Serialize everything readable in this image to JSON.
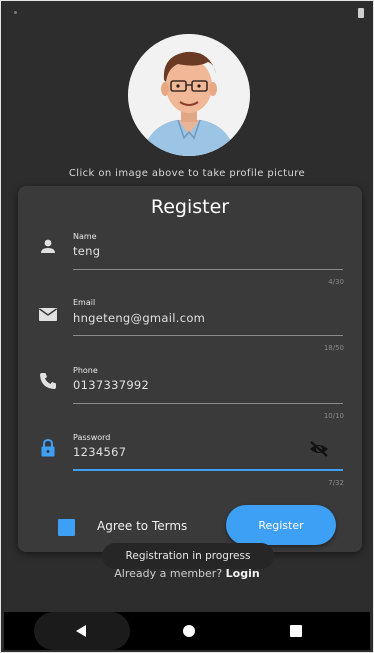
{
  "hint_text": "Click on image above to take profile picture",
  "card": {
    "title": "Register",
    "fields": [
      {
        "label": "Name",
        "value": "teng",
        "counter": "4/30",
        "icon": "person-icon"
      },
      {
        "label": "Email",
        "value": "hngeteng@gmail.com",
        "counter": "18/50",
        "icon": "mail-icon"
      },
      {
        "label": "Phone",
        "value": "0137337992",
        "counter": "10/10",
        "icon": "phone-icon"
      },
      {
        "label": "Password",
        "value": "1234567",
        "counter": "7/32",
        "icon": "lock-icon"
      }
    ],
    "agree_label": "Agree to Terms",
    "register_label": "Register"
  },
  "toast": "Registration in progress",
  "member_text": "Already a member?",
  "login_label": "Login",
  "colors": {
    "accent": "#3da0f5",
    "background": "#2d2d2d",
    "card": "#3a3a3b"
  }
}
